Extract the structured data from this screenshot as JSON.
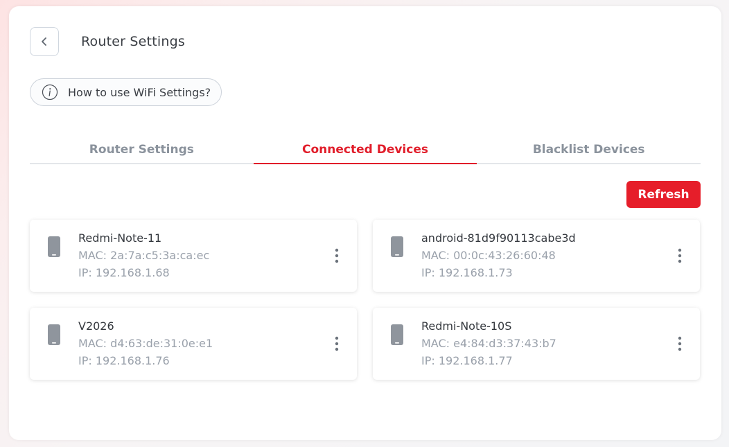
{
  "header": {
    "title": "Router Settings",
    "back_icon": "chevron-left-icon"
  },
  "help": {
    "label": "How to use WiFi Settings?",
    "icon": "info-icon"
  },
  "tabs": [
    {
      "label": "Router Settings",
      "active": false
    },
    {
      "label": "Connected Devices",
      "active": true
    },
    {
      "label": "Blacklist Devices",
      "active": false
    }
  ],
  "refresh_label": "Refresh",
  "colors": {
    "accent": "#e61e2a",
    "muted_text": "#9aa1ab",
    "icon_gray": "#8f959d"
  },
  "devices": [
    {
      "name": "Redmi-Note-11",
      "mac": "MAC: 2a:7a:c5:3a:ca:ec",
      "ip": "IP: 192.168.1.68"
    },
    {
      "name": "android-81d9f90113cabe3d",
      "mac": "MAC: 00:0c:43:26:60:48",
      "ip": "IP: 192.168.1.73"
    },
    {
      "name": "V2026",
      "mac": "MAC: d4:63:de:31:0e:e1",
      "ip": "IP: 192.168.1.76"
    },
    {
      "name": "Redmi-Note-10S",
      "mac": "MAC: e4:84:d3:37:43:b7",
      "ip": "IP: 192.168.1.77"
    }
  ]
}
